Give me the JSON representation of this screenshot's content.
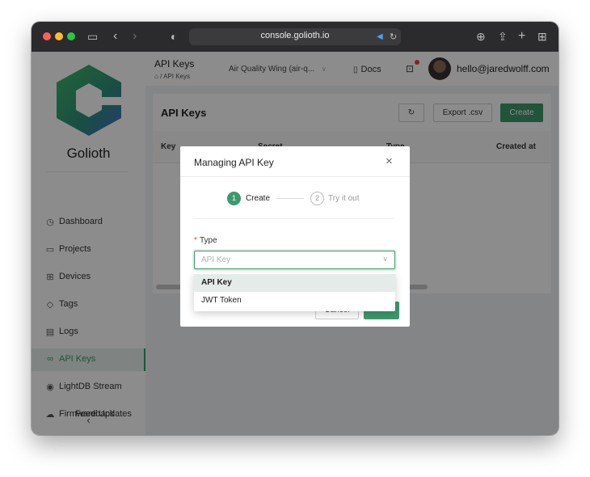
{
  "browser": {
    "url": "console.golioth.io",
    "traffic_colors": [
      "#fe5f57",
      "#febc2e",
      "#28c840"
    ]
  },
  "sidebar": {
    "brand": "Golioth",
    "items": [
      {
        "label": "Dashboard",
        "icon": "dashboard-icon",
        "glyph": "◷"
      },
      {
        "label": "Projects",
        "icon": "folder-icon",
        "glyph": "▭"
      },
      {
        "label": "Devices",
        "icon": "devices-icon",
        "glyph": "⊞"
      },
      {
        "label": "Tags",
        "icon": "tag-icon",
        "glyph": "◇"
      },
      {
        "label": "Logs",
        "icon": "logs-icon",
        "glyph": "▤"
      },
      {
        "label": "API Keys",
        "icon": "link-icon",
        "glyph": "∞"
      },
      {
        "label": "LightDB Stream",
        "icon": "stream-icon",
        "glyph": "◉"
      },
      {
        "label": "Firmware Updates",
        "icon": "cloud-icon",
        "glyph": "☁"
      }
    ],
    "feedback_label": "Feedback",
    "collapse_glyph": "‹",
    "accent": "#3c9a6b"
  },
  "header": {
    "title": "API Keys",
    "breadcrumb_home": "⌂",
    "breadcrumb_sep": "/",
    "breadcrumb_current": "API Keys",
    "project": "Air Quality Wing (air-q...",
    "docs_label": "Docs",
    "user_email": "hello@jaredwolff.com"
  },
  "page": {
    "title": "API Keys",
    "export_label": "Export .csv",
    "create_label": "Create",
    "columns": [
      "Key",
      "Secret",
      "Type",
      "Created at"
    ]
  },
  "modal": {
    "title": "Managing API Key",
    "steps": [
      {
        "number": "1",
        "label": "Create"
      },
      {
        "number": "2",
        "label": "Try it out"
      }
    ],
    "required_mark": "*",
    "field_label": "Type",
    "select_placeholder": "API Key",
    "cancel_label": "Cancel",
    "save_label": "Save",
    "options": [
      "API Key",
      "JWT Token"
    ]
  }
}
